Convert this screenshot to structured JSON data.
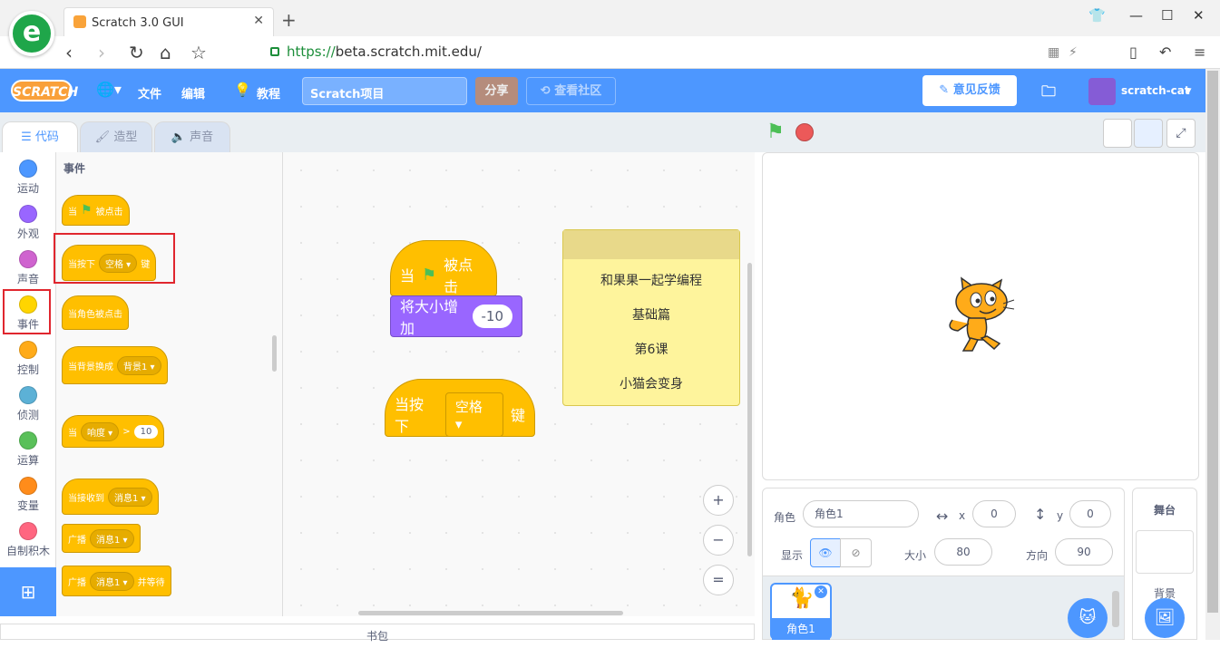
{
  "browser": {
    "tab_title": "Scratch 3.0 GUI",
    "new_tab": "+",
    "url_scheme": "https://",
    "url_host": "beta.scratch.mit.edu",
    "url_path": "/"
  },
  "menubar": {
    "logo": "SCRATCH",
    "file": "文件",
    "edit": "编辑",
    "tutorials": "教程",
    "project_title": "Scratch项目",
    "share": "分享",
    "see_community": "查看社区",
    "feedback": "意见反馈",
    "username": "scratch-cat"
  },
  "tabs": {
    "code": "代码",
    "costumes": "造型",
    "sounds": "声音"
  },
  "categories": [
    {
      "label": "运动",
      "color": "#4c97ff"
    },
    {
      "label": "外观",
      "color": "#9966ff"
    },
    {
      "label": "声音",
      "color": "#cf63cf"
    },
    {
      "label": "事件",
      "color": "#ffd500"
    },
    {
      "label": "控制",
      "color": "#ffab19"
    },
    {
      "label": "侦测",
      "color": "#5cb1d6"
    },
    {
      "label": "运算",
      "color": "#59c059"
    },
    {
      "label": "变量",
      "color": "#ff8c1a"
    },
    {
      "label": "自制积木",
      "color": "#ff6680"
    }
  ],
  "palette": {
    "title": "事件",
    "flag_when": "当",
    "flag_clicked": "被点击",
    "key_when": "当按下",
    "key_value": "空格",
    "key_suffix": "键",
    "sprite_clicked": "当角色被点击",
    "backdrop_when": "当背景换成",
    "backdrop_value": "背景1",
    "loudness_when": "当",
    "loudness_value": "响度",
    "gt": ">",
    "loudness_num": "10",
    "receive_when": "当接收到",
    "message_value": "消息1",
    "broadcast": "广播",
    "broadcast_wait_suffix": "并等待"
  },
  "workspace": {
    "hat_when": "当",
    "hat_clicked": "被点击",
    "size_label": "将大小增加",
    "size_value": "-10",
    "key_when": "当按下",
    "key_value": "空格",
    "key_suffix": "键",
    "note_lines": [
      "和果果一起学编程",
      "基础篇",
      "第6课",
      "小猫会变身"
    ],
    "zoom_in": "+",
    "zoom_out": "−",
    "zoom_reset": "="
  },
  "sprite_info": {
    "sprite_label": "角色",
    "sprite_name": "角色1",
    "x_label": "x",
    "x_value": "0",
    "y_label": "y",
    "y_value": "0",
    "show_label": "显示",
    "size_label": "大小",
    "size_value": "80",
    "direction_label": "方向",
    "direction_value": "90"
  },
  "sprite_list": {
    "sprite_name": "角色1"
  },
  "stage_panel": {
    "title": "舞台",
    "backdrops_label": "背景"
  },
  "backpack": "书包"
}
